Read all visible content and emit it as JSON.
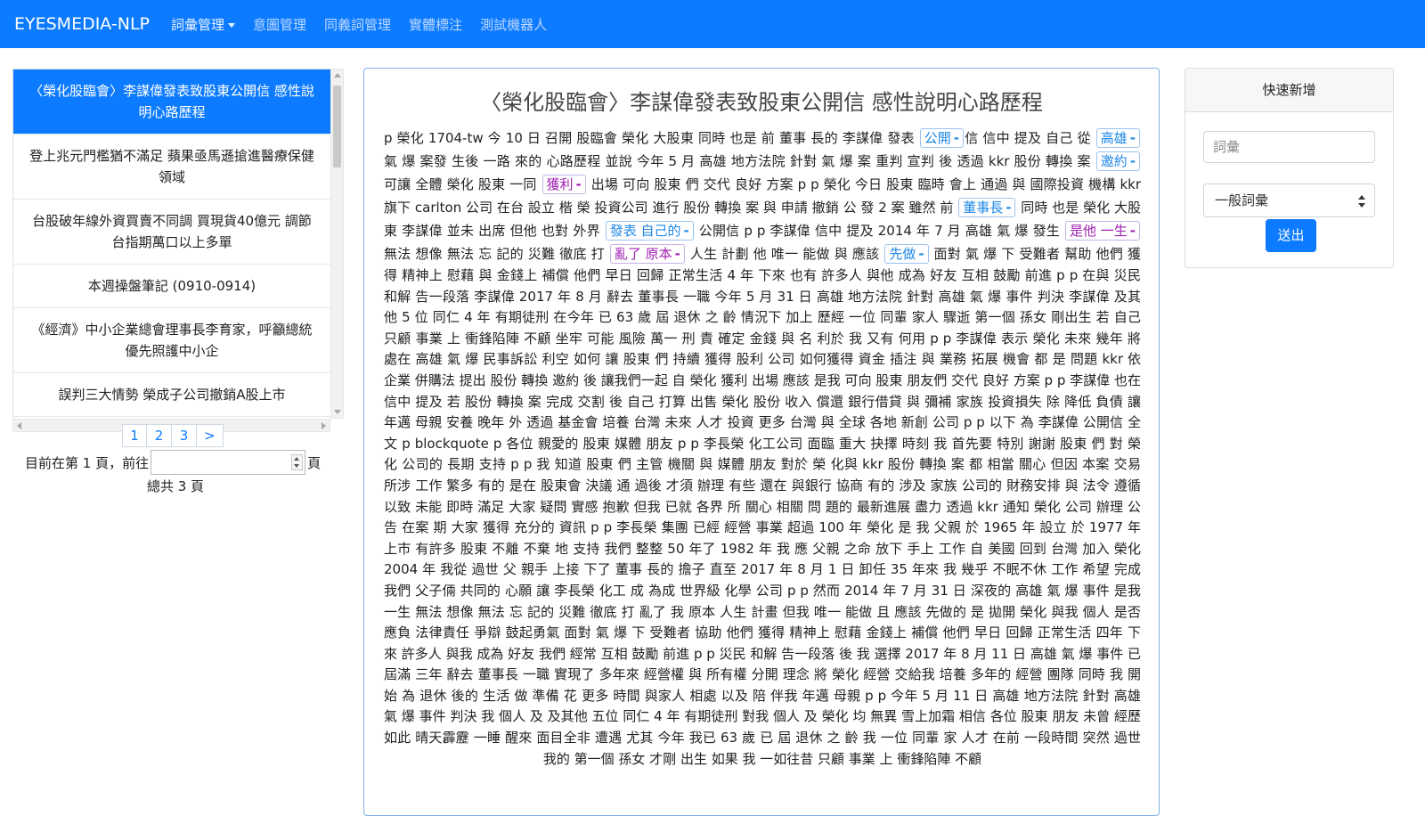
{
  "nav": {
    "brand": "EYESMEDIA-NLP",
    "items": [
      "詞彙管理",
      "意圖管理",
      "同義詞管理",
      "實體標注",
      "測試機器人"
    ]
  },
  "sidebar": {
    "articles": [
      "〈榮化股臨會〉李謀偉發表致股東公開信 感性說明心路歷程",
      "登上兆元門檻猶不滿足 蘋果亟馬遜搶進醫療保健領域",
      "台股破年線外資買賣不同調 買現貨40億元 調節台指期萬口以上多單",
      "本週操盤筆記 (0910-0914)",
      "《經濟》中小企業總會理事長李育家，呼籲總統優先照護中小企",
      "誤判三大情勢 榮成子公司撤銷A股上市"
    ],
    "pagination": [
      "1",
      "2",
      "3",
      ">"
    ],
    "goto_prefix": "目前在第 1 頁，前往",
    "goto_suffix": "頁",
    "total": "總共 3 頁"
  },
  "article": {
    "title": "〈榮化股臨會〉李謀偉發表致股東公開信 感性說明心路歷程",
    "segments": [
      {
        "text": "p 榮化 1704-tw 今 10 日 召開 股臨會 榮化 大股東 同時 也是 前 董事 長的 李謀偉 發表 "
      },
      {
        "tag": "公開",
        "color": "blue"
      },
      {
        "text": "信 信中 提及 自己 從 "
      },
      {
        "tag": "高雄",
        "color": "blue"
      },
      {
        "text": " 氣 爆 案發 生後 一路 來的 心路歷程 並說 今年 5 月 高雄 地方法院 針對 氣 爆 案 重判 宣判 後 透過 kkr 股份 轉換 案 "
      },
      {
        "tag": "邀約",
        "color": "blue"
      },
      {
        "text": " 可讓 全體 榮化 股東 一同 "
      },
      {
        "tag": "獲利",
        "color": "purple"
      },
      {
        "text": " 出場 可向 股東 們 交代 良好 方案 p p 榮化 今日 股東 臨時 會上 通過 與 國際投資 機構 kkr 旗下 carlton 公司 在台 設立 楷 榮 投資公司 進行 股份 轉換 案 與 申請 撤銷 公 發 2 案 雖然 前 "
      },
      {
        "tag": "董事長",
        "color": "blue"
      },
      {
        "text": " 同時 也是 榮化 大股東 李謀偉 並未 出席 但他 也對 外界 "
      },
      {
        "tag": "發表 自己的",
        "color": "blue"
      },
      {
        "text": " 公開信 p p 李謀偉 信中 提及 2014 年 7 月 高雄 氣 爆 發生 "
      },
      {
        "tag": "是他 一生",
        "color": "purple"
      },
      {
        "text": " 無法 想像 無法 忘 記的 災難 徹底 打 "
      },
      {
        "tag": "亂了 原本",
        "color": "purple"
      },
      {
        "text": " 人生 計劃 他 唯一 能做 與 應該 "
      },
      {
        "tag": "先做",
        "color": "blue"
      },
      {
        "text": " 面對 氣 爆 下 受難者 幫助 他們 獲得 精神上 慰藉 與 金錢上 補償 他們 早日 回歸 正常生活 4 年 下來 也有 許多人 與他 成為 好友 互相 鼓勵 前進 p p 在與 災民 和解 告一段落 李謀偉 2017 年 8 月 辭去 董事長 一職 今年 5 月 31 日 高雄 地方法院 針對 高雄 氣 爆 事件 判決 李謀偉 及其他 5 位 同仁 4 年 有期徒刑 在今年 已 63 歲 屆 退休 之 齡 情況下 加上 歷經 一位 同輩 家人 驟逝 第一個 孫女 剛出生 若 自己 只顧 事業 上 衝鋒陷陣 不顧 坐牢 可能 風險 萬一 刑 責 確定 金錢 與 名 利於 我 又有 何用 p p 李謀偉 表示 榮化 未來 幾年 將 處在 高雄 氣 爆 民事訴訟 利空 如何 讓 股東 們 持續 獲得 股利 公司 如何獲得 資金 插注 與 業務 拓展 機會 都 是 問題 kkr 依 企業 併購法 提出 股份 轉換 邀約 後 讓我們一起 自 榮化 獲利 出場 應該 是我 可向 股東 朋友們 交代 良好 方案 p p 李謀偉 也在 信中 提及 若 股份 轉換 案 完成 交割 後 自己 打算 出售 榮化 股份 收入 償還 銀行借貸 與 彌補 家族 投資損失 除 降低 負債 讓 年邁 母親 安養 晚年 外 透過 基金會 培養 台灣 未來 人才 投資 更多 台灣 與 全球 各地 新創 公司 p p 以下 為 李謀偉 公開信 全文 p blockquote p 各位 親愛的 股東 媒體 朋友 p p 李長榮 化工公司 面臨 重大 抉擇 時刻 我 首先要 特別 謝謝 股東 們 對 榮化 公司的 長期 支持 p p 我 知道 股東 們 主管 機關 與 媒體 朋友 對於 榮 化與 kkr 股份 轉換 案 都 相當 關心 但因 本案 交易 所涉 工作 繁多 有的 是在 股東會 決議 通 過後 才須 辦理 有些 還在 與銀行 協商 有的 涉及 家族 公司的 財務安排 與 法令 遵循 以致 未能 即時 滿足 大家 疑問 實感 抱歉 但我 已就 各界 所 關心 相關 問 題的 最新進展 盡力 透過 kkr 通知 榮化 公司 辦理 公告 在案 期 大家 獲得 充分的 資訊 p p 李長榮 集團 已經 經營 事業 超過 100 年 榮化 是 我 父親 於 1965 年 設立 於 1977 年 上市 有許多 股東 不離 不棄 地 支持 我們 整整 50 年了 1982 年 我 應 父親 之命 放下 手上 工作 自 美國 回到 台灣 加入 榮化 2004 年 我從 過世 父 親手 上接 下了 董事 長的 擔子 直至 2017 年 8 月 1 日 卸任 35 年來 我 幾乎 不眠不休 工作 希望 完成 我們 父子倆 共同的 心願 讓 李長榮 化工 成 為成 世界級 化學 公司 p p 然而 2014 年 7 月 31 日 深夜的 高雄 氣 爆 事件 是我 一生 無法 想像 無法 忘 記的 災難 徹底 打 亂了 我 原本 人生 計畫 但我 唯一 能做 且 應該 先做的 是 拋開 榮化 與我 個人 是否 應負 法律責任 爭辯 鼓起勇氣 面對 氣 爆 下 受難者 協助 他們 獲得 精神上 慰藉 金錢上 補償 他們 早日 回歸 正常生活 四年 下來 許多人 與我 成為 好友 我們 經常 互相 鼓勵 前進 p p 災民 和解 告一段落 後 我 選擇 2017 年 8 月 11 日 高雄 氣 爆 事件 已 屆滿 三年 辭去 董事長 一職 實現了 多年來 經營權 與 所有權 分開 理念 將 榮化 經營 交給我 培養 多年的 經營 團隊 同時 我 開始 為 退休 後的 生活 做 準備 花 更多 時間 與家人 相處 以及 陪 伴我 年邁 母親 p p 今年 5 月 11 日 高雄 地方法院 針對 高雄 氣 爆 事件 判決 我 個人 及 及其他 五位 同仁 4 年 有期徒刑 對我 個人 及 榮化 均 無異 雪上加霜 相信 各位 股東 朋友 未曾 經歷 如此 晴天霹靂 一睡 醒來 面目全非 遭遇 尤其 今年 我已 63 歲 已 屆 退休 之 齡 我 一位 同輩 家 人才 在前 一段時間 突然 過世 我的 第一個 孫女 才剛 出生 如果 我 一如往昔 只顧 事業 上 衝鋒陷陣 不顧"
      }
    ]
  },
  "quick_add": {
    "title": "快速新增",
    "input_placeholder": "詞彙",
    "select_value": "一般詞彙",
    "submit_label": "送出"
  },
  "colors": {
    "primary": "#0d7bff",
    "tag_blue": "#1f88e8",
    "tag_purple": "#a020b0"
  }
}
